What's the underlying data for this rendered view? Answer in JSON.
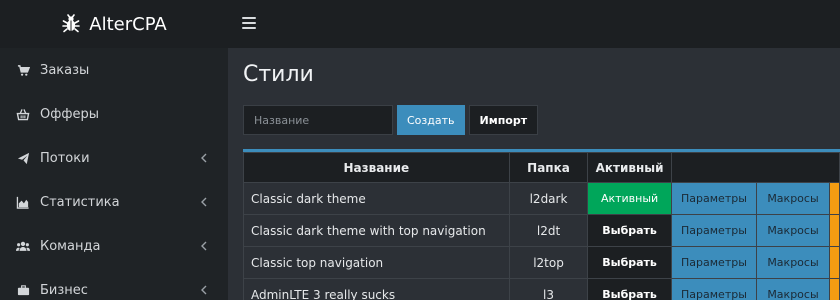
{
  "brand": {
    "name": "AlterCPA",
    "icon": "bug-icon"
  },
  "colors": {
    "accent": "#3c8dbc",
    "success": "#00a65a",
    "warning": "#f39c12",
    "dark": "#1c1f22"
  },
  "sidebar": {
    "items": [
      {
        "label": "Заказы",
        "icon": "cart-icon",
        "has_submenu": false
      },
      {
        "label": "Офферы",
        "icon": "basket-icon",
        "has_submenu": false
      },
      {
        "label": "Потоки",
        "icon": "paper-plane-icon",
        "has_submenu": true
      },
      {
        "label": "Статистика",
        "icon": "area-chart-icon",
        "has_submenu": true
      },
      {
        "label": "Команда",
        "icon": "users-icon",
        "has_submenu": true
      },
      {
        "label": "Бизнес",
        "icon": "briefcase-icon",
        "has_submenu": true
      }
    ]
  },
  "main": {
    "title": "Стили",
    "form": {
      "name_placeholder": "Название",
      "create_label": "Создать",
      "import_label": "Импорт"
    },
    "table": {
      "headers": [
        "Название",
        "Папка",
        "Активный",
        ""
      ],
      "params_label": "Параметры",
      "macros_label": "Макросы",
      "active_label": "Активный",
      "select_label": "Выбрать",
      "rows": [
        {
          "name": "Classic dark theme",
          "folder": "l2dark",
          "active": true
        },
        {
          "name": "Classic dark theme with top navigation",
          "folder": "l2dt",
          "active": false
        },
        {
          "name": "Classic top navigation",
          "folder": "l2top",
          "active": false
        },
        {
          "name": "AdminLTE 3 really sucks",
          "folder": "l3",
          "active": false
        }
      ]
    }
  }
}
